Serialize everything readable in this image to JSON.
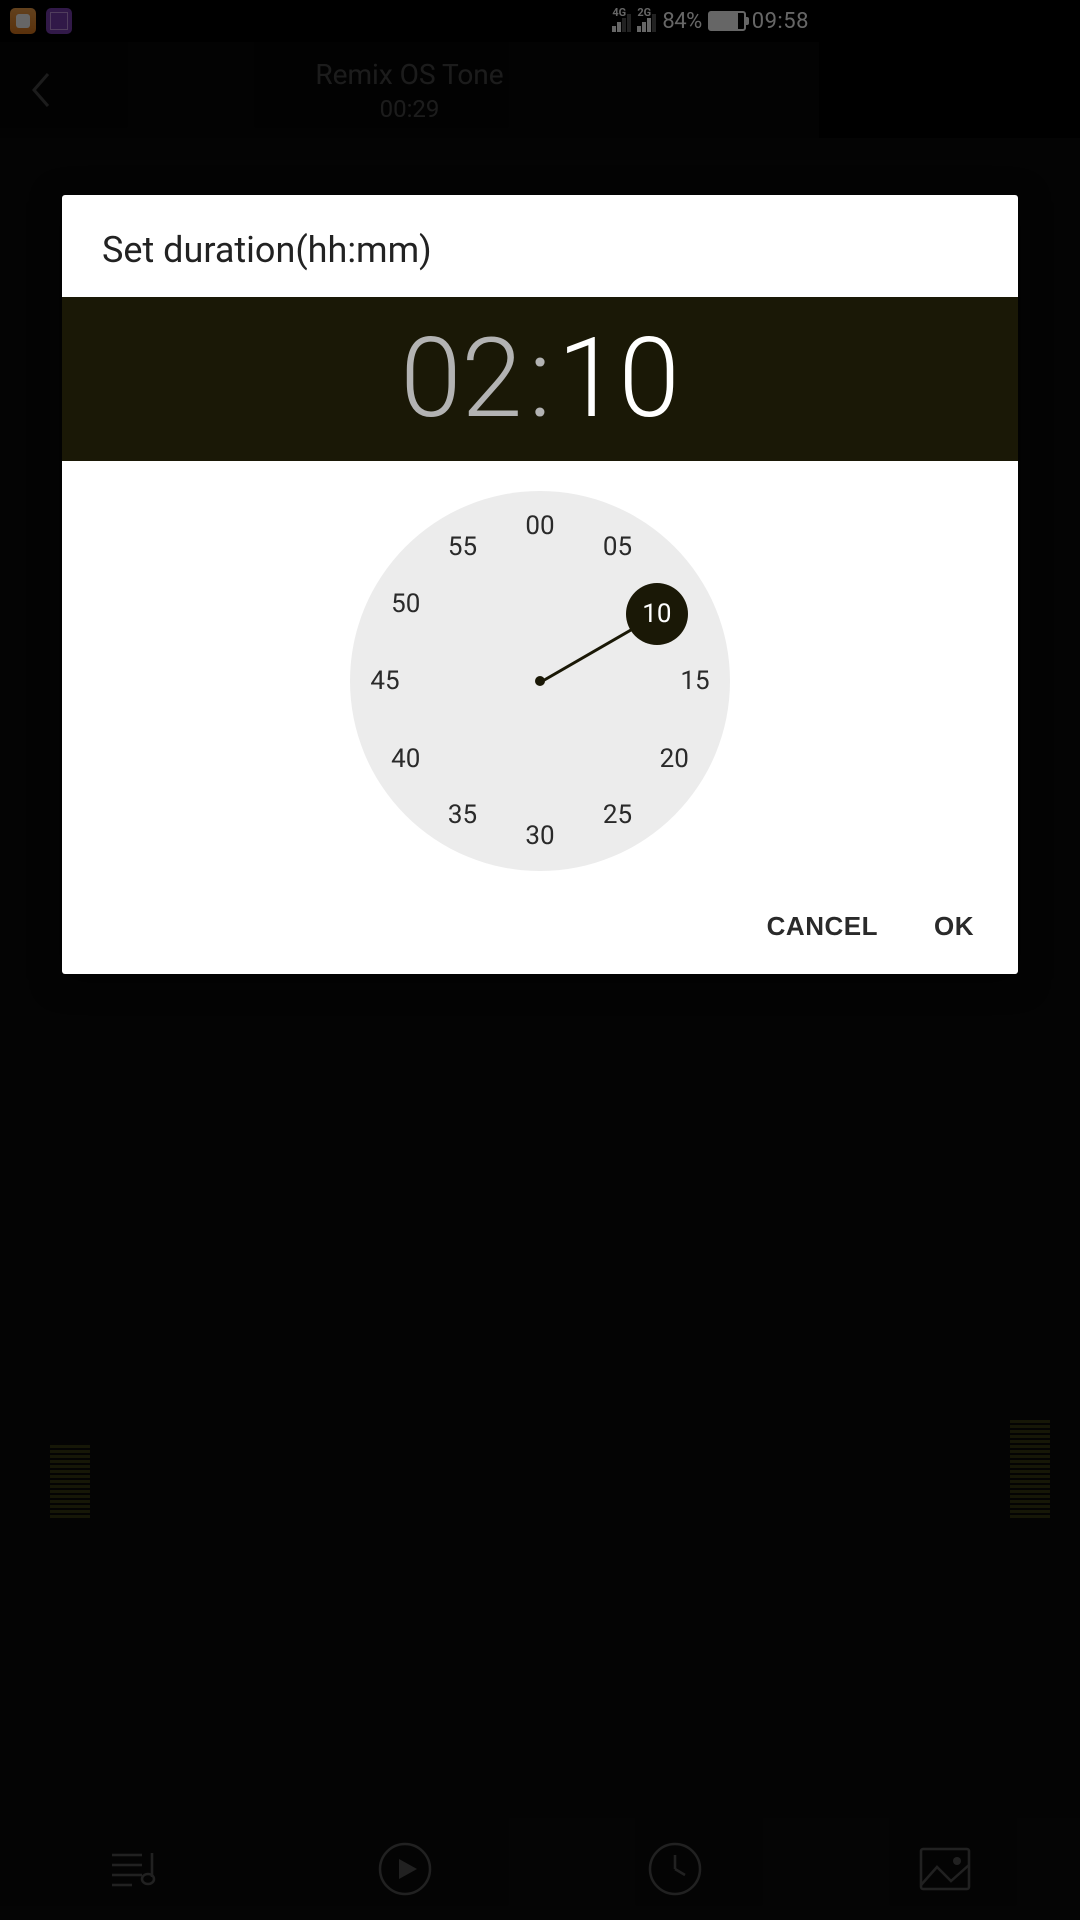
{
  "status": {
    "net1_label": "4G",
    "net2_label": "2G",
    "battery_pct": "84%",
    "clock": "09:58"
  },
  "header": {
    "title": "Remix OS Tone",
    "elapsed": "00:29"
  },
  "dialog": {
    "title": "Set duration(hh:mm)",
    "hours": "02",
    "minutes": "10",
    "selected_minute": "10",
    "selected_angle_deg": -30,
    "ticks": [
      "00",
      "05",
      "10",
      "15",
      "20",
      "25",
      "30",
      "35",
      "40",
      "45",
      "50",
      "55"
    ],
    "cancel": "CANCEL",
    "ok": "OK"
  },
  "nav": {
    "playlist_icon": "playlist",
    "play_icon": "play",
    "timer_icon": "timer",
    "picture_icon": "picture"
  }
}
